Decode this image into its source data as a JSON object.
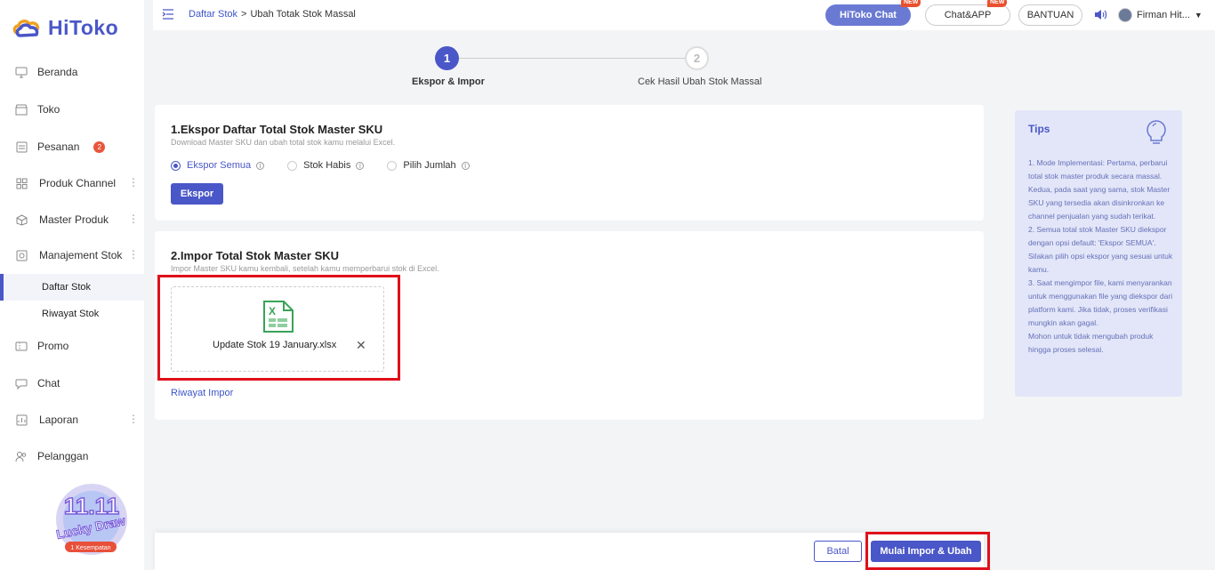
{
  "app": {
    "logo_text": "HiToko"
  },
  "sidebar": {
    "items": [
      {
        "label": "Beranda",
        "icon": "monitor-icon"
      },
      {
        "label": "Toko",
        "icon": "store-icon"
      },
      {
        "label": "Pesanan",
        "icon": "orders-icon",
        "badge": "2"
      },
      {
        "label": "Produk Channel",
        "icon": "grid-icon"
      },
      {
        "label": "Master Produk",
        "icon": "box-icon"
      },
      {
        "label": "Manajement Stok",
        "icon": "stock-icon"
      },
      {
        "label": "Promo",
        "icon": "ticket-icon"
      },
      {
        "label": "Chat",
        "icon": "chat-bubble-icon"
      },
      {
        "label": "Laporan",
        "icon": "report-icon"
      },
      {
        "label": "Pelanggan",
        "icon": "users-icon"
      }
    ],
    "sub_items": [
      "Daftar Stok",
      "Riwayat Stok"
    ],
    "promo": {
      "title": "11.11",
      "subtitle": "Lucky Draw",
      "chances": "1 Kesempatan"
    }
  },
  "header": {
    "breadcrumb_link": "Daftar Stok",
    "breadcrumb_sep": ">",
    "breadcrumb_current": "Ubah Totak Stok Massal",
    "hitoko_chat": "HiToko Chat",
    "chat_app": "Chat&APP",
    "new_label": "NEW",
    "help": "BANTUAN",
    "user_name": "Firman Hit..."
  },
  "stepper": {
    "step1_num": "1",
    "step1_label": "Ekspor & Impor",
    "step2_num": "2",
    "step2_label": "Cek Hasil Ubah Stok Massal"
  },
  "export_section": {
    "title": "1.Ekspor Daftar Total Stok Master SKU",
    "subtitle": "Download Master SKU dan ubah total stok kamu melalui Excel.",
    "options": [
      "Ekspor Semua",
      "Stok Habis",
      "Pilih Jumlah"
    ],
    "selected_option": "Ekspor Semua",
    "button": "Ekspor"
  },
  "import_section": {
    "title": "2.Impor Total Stok Master SKU",
    "subtitle": "Impor Master SKU kamu kembali, setelah kamu memperbarui stok di Excel.",
    "file_name": "Update Stok 19 January.xlsx",
    "history_link": "Riwayat Impor"
  },
  "tips": {
    "title": "Tips",
    "body": "1. Mode Implementasi: Pertama, perbarui total stok master produk secara massal. Kedua, pada saat yang sama, stok Master SKU yang tersedia akan disinkronkan ke channel penjualan yang sudah terikat.\n2. Semua total stok Master SKU diekspor dengan opsi default: 'Ekspor SEMUA'. Silakan pilih opsi ekspor yang sesuai untuk kamu.\n3. Saat mengimpor file, kami menyarankan untuk menggunakan file yang diekspor dari platform kami. Jika tidak, proses verifikasi mungkin akan gagal.\nMohon untuk tidak mengubah produk hingga proses selesai."
  },
  "footer": {
    "cancel": "Batal",
    "start": "Mulai Impor & Ubah"
  },
  "colors": {
    "primary": "#4a57c8",
    "highlight_frame": "#e0101a",
    "tips_bg": "#e3e6f8",
    "badge": "#e8553b"
  }
}
